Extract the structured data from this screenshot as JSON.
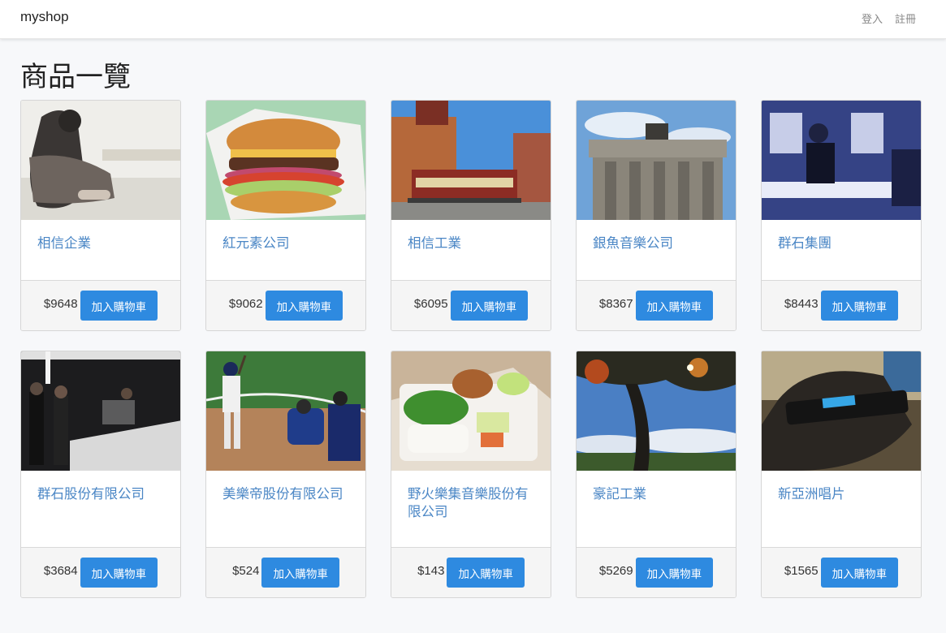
{
  "nav": {
    "brand": "myshop",
    "login": "登入",
    "register": "註冊"
  },
  "page": {
    "title": "商品一覽"
  },
  "products": [
    {
      "name": "相信企業",
      "price": "$9648",
      "button": "加入購物車",
      "image": "woman-sitting-photo"
    },
    {
      "name": "紅元素公司",
      "price": "$9062",
      "button": "加入購物車",
      "image": "hamburger-photo"
    },
    {
      "name": "相信工業",
      "price": "$6095",
      "button": "加入購物車",
      "image": "cable-car-street-photo"
    },
    {
      "name": "銀魚音樂公司",
      "price": "$8367",
      "button": "加入購物車",
      "image": "brandenburg-gate-photo"
    },
    {
      "name": "群石集團",
      "price": "$8443",
      "button": "加入購物車",
      "image": "bartender-photo"
    },
    {
      "name": "群石股份有限公司",
      "price": "$3684",
      "button": "加入購物車",
      "image": "bar-crowd-photo"
    },
    {
      "name": "美樂帝股份有限公司",
      "price": "$524",
      "button": "加入購物車",
      "image": "baseball-batter-photo"
    },
    {
      "name": "野火樂集音樂股份有限公司",
      "price": "$143",
      "button": "加入購物車",
      "image": "bento-box-photo"
    },
    {
      "name": "豪記工業",
      "price": "$5269",
      "button": "加入購物車",
      "image": "autumn-tree-photo"
    },
    {
      "name": "新亞洲唱片",
      "price": "$1565",
      "button": "加入購物車",
      "image": "sony-walkman-photo"
    }
  ],
  "colors": {
    "link": "#4a86c5",
    "button": "#2e8ae0",
    "background": "#f7f8fa"
  }
}
